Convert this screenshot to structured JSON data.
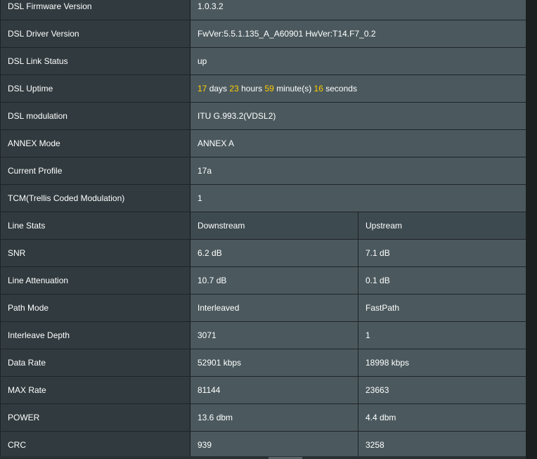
{
  "rows": [
    {
      "label": "DSL Firmware Version",
      "value": "1.0.3.2"
    },
    {
      "label": "DSL Driver Version",
      "value": "FwVer:5.5.1.135_A_A60901 HwVer:T14.F7_0.2"
    },
    {
      "label": "DSL Link Status",
      "value": "up"
    },
    {
      "label": "DSL Uptime",
      "days": "17",
      "days_unit": "days",
      "hours": "23",
      "hours_unit": "hours",
      "minutes": "59",
      "minutes_unit": "minute(s)",
      "seconds": "16",
      "seconds_unit": "seconds"
    },
    {
      "label": "DSL modulation",
      "value": "ITU G.993.2(VDSL2)"
    },
    {
      "label": "ANNEX Mode",
      "value": "ANNEX A"
    },
    {
      "label": "Current Profile",
      "value": "17a"
    },
    {
      "label": "TCM(Trellis Coded Modulation)",
      "value": "1"
    }
  ],
  "line_stats": {
    "header": {
      "label": "Line Stats",
      "downstream": "Downstream",
      "upstream": "Upstream"
    },
    "rows": [
      {
        "label": "SNR",
        "downstream": "6.2 dB",
        "upstream": "7.1 dB"
      },
      {
        "label": "Line Attenuation",
        "downstream": "10.7 dB",
        "upstream": "0.1 dB"
      },
      {
        "label": "Path Mode",
        "downstream": "Interleaved",
        "upstream": "FastPath"
      },
      {
        "label": "Interleave Depth",
        "downstream": "3071",
        "upstream": "1"
      },
      {
        "label": "Data Rate",
        "downstream": "52901 kbps",
        "upstream": "18998 kbps"
      },
      {
        "label": "MAX Rate",
        "downstream": "81144",
        "upstream": "23663"
      },
      {
        "label": "POWER",
        "downstream": "13.6 dbm",
        "upstream": "4.4 dbm"
      },
      {
        "label": "CRC",
        "downstream": "939",
        "upstream": "3258"
      }
    ]
  },
  "colors": {
    "label_bg": "#313b3f",
    "value_bg": "#4b595e",
    "header_value_bg": "#3d4a4f",
    "highlight": "#ffcc00",
    "text": "#ffffff"
  }
}
